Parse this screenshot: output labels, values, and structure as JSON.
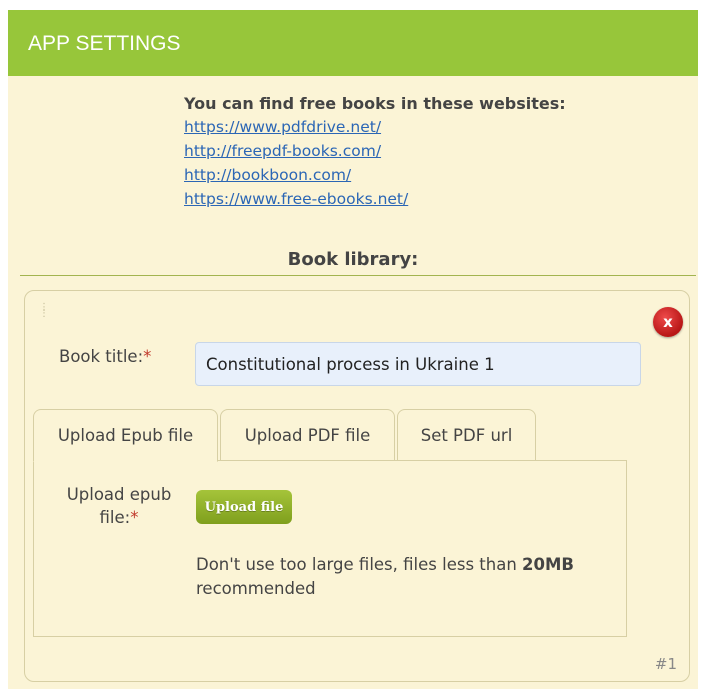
{
  "header": {
    "title": "APP SETTINGS"
  },
  "intro": {
    "heading": "You can find free books in these websites:",
    "links": [
      "https://www.pdfdrive.net/",
      "http://freepdf-books.com/",
      "http://bookboon.com/",
      "https://www.free-ebooks.net/"
    ]
  },
  "library": {
    "title": "Book library:",
    "book": {
      "title_label": "Book title:",
      "required_mark": "*",
      "title_value": "Constitutional process in Ukraine 1",
      "remove_icon": "x",
      "tabs": [
        "Upload Epub file",
        "Upload PDF file",
        "Set PDF url"
      ],
      "active_tab": "Upload Epub file",
      "upload_label": "Upload epub file:",
      "upload_button": "Upload file",
      "note_text": "Don't use too large files, files less than ",
      "note_bold": "20MB",
      "note_end": " recommended",
      "index": "#1"
    }
  },
  "colors": {
    "header_bg": "#97c63a",
    "panel_bg": "#fbf4d6",
    "link": "#2b66b5",
    "remove_button": "#d42525",
    "upload_button": "#8fb02a"
  }
}
